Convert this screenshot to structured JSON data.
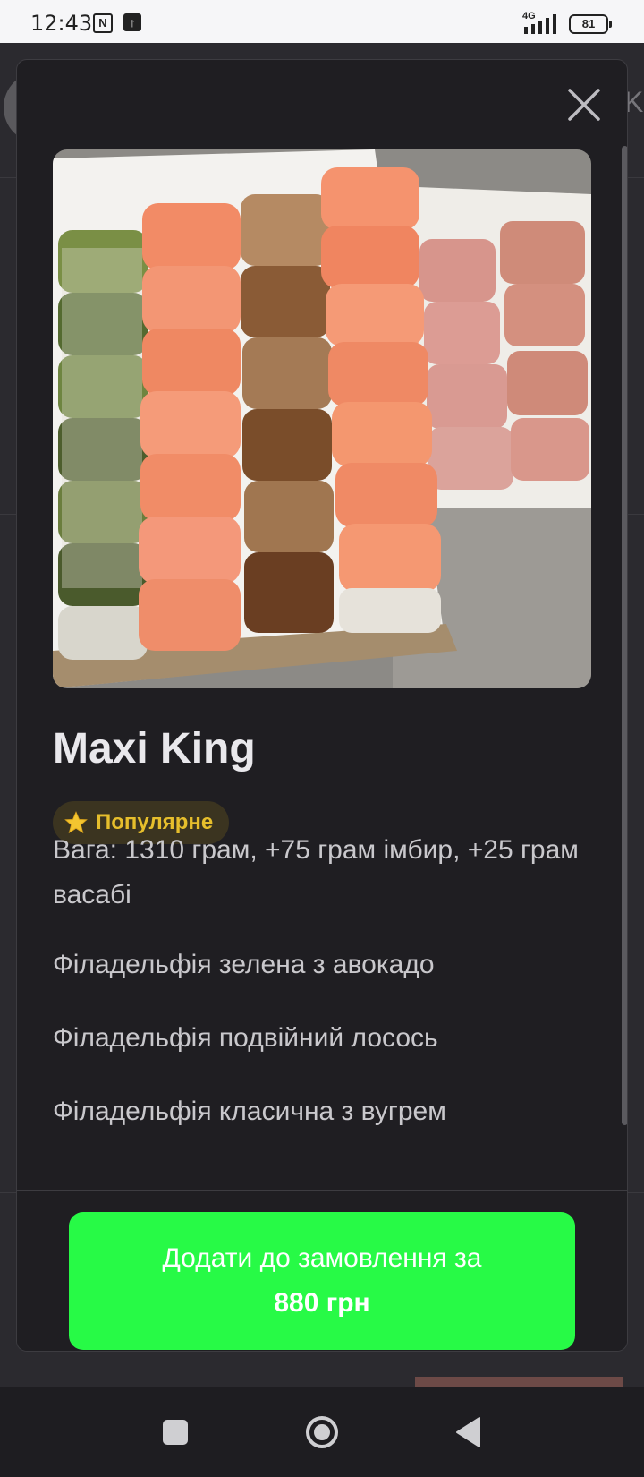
{
  "status_bar": {
    "time": "12:43",
    "network": "4G",
    "battery": "81",
    "icons": [
      "nfc-icon",
      "upload-icon",
      "signal-icon",
      "battery-icon"
    ]
  },
  "background_page": {
    "tab_fragment": "Ka"
  },
  "modal": {
    "close_icon": "close-icon",
    "product": {
      "image_alt": "Maxi King sushi set photo",
      "name": "Maxi King",
      "badge": {
        "icon": "star-icon",
        "label": "Популярне",
        "color": "#e6be2c"
      },
      "description": [
        "Вага: 1310 грам, +75 грам імбир, +25 грам васабі",
        "Філадельфія зелена з авокадо",
        "Філадельфія подвійний лосось",
        "Філадельфія класична з вугрем"
      ]
    },
    "order_button": {
      "line1": "Додати до замовлення за",
      "line2": "880 грн",
      "color": "#27fa46"
    }
  },
  "nav_bar": {
    "icons": [
      "recent-apps-icon",
      "home-icon",
      "back-icon"
    ]
  }
}
